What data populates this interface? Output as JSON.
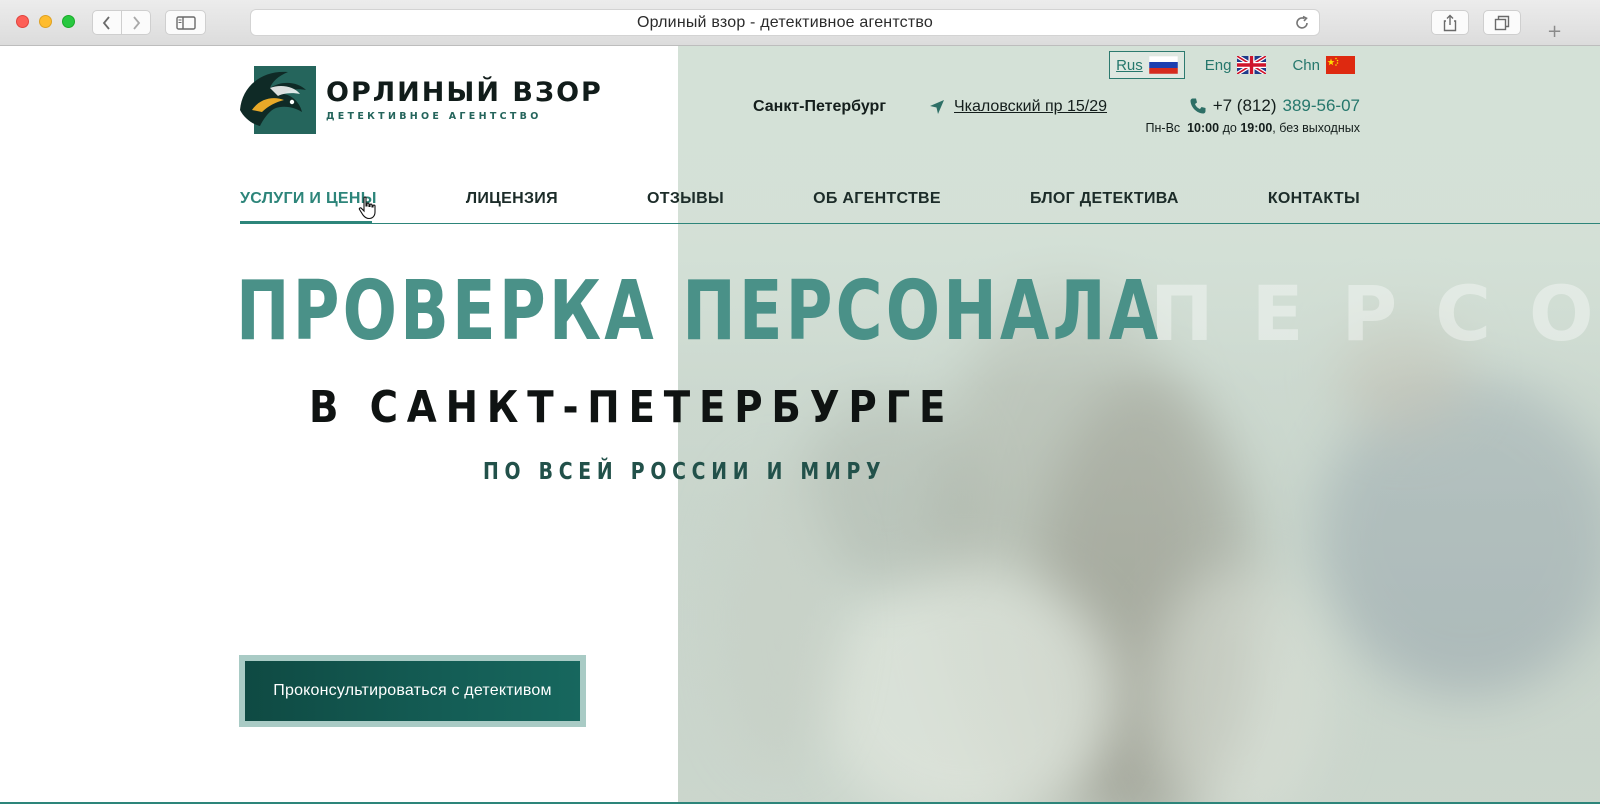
{
  "browser": {
    "url_title": "Орлиный взор - детективное агентство",
    "new_tab_symbol": "+"
  },
  "header": {
    "logo": {
      "name": "ОРЛИНЫЙ ВЗОР",
      "subtitle": "ДЕТЕКТИВНОЕ АГЕНТСТВО"
    },
    "languages": [
      {
        "label": "Rus",
        "flag": "russia-flag",
        "active": true
      },
      {
        "label": "Eng",
        "flag": "uk-flag",
        "active": false
      },
      {
        "label": "Chn",
        "flag": "china-flag",
        "active": false
      }
    ],
    "city": "Санкт-Петербург",
    "address": "Чкаловский пр 15/29",
    "phone": {
      "prefix": "+7 (812)",
      "number": "389-56-07"
    },
    "hours": {
      "days": "Пн-Вс",
      "from": "10:00",
      "sep": "до",
      "to": "19:00",
      "note": ", без выходных"
    }
  },
  "nav": {
    "items": [
      {
        "label": "УСЛУГИ И ЦЕНЫ",
        "active": true
      },
      {
        "label": "ЛИЦЕНЗИЯ",
        "active": false
      },
      {
        "label": "ОТЗЫВЫ",
        "active": false
      },
      {
        "label": "ОБ АГЕНТСТВЕ",
        "active": false
      },
      {
        "label": "БЛОГ ДЕТЕКТИВА",
        "active": false
      },
      {
        "label": "КОНТАКТЫ",
        "active": false
      }
    ]
  },
  "hero": {
    "title": "ПРОВЕРКА ПЕРСОНАЛА",
    "ghost_text": "ПЕРСОН",
    "subtitle": "В САНКТ-ПЕТЕРБУРГЕ",
    "subtitle2": "ПО ВСЕЙ РОССИИ И МИРУ",
    "cta_label": "Проконсультироваться с детективом"
  },
  "colors": {
    "accent": "#2d857a",
    "dark_green": "#0f4a43",
    "title_green": "#4a9188"
  }
}
